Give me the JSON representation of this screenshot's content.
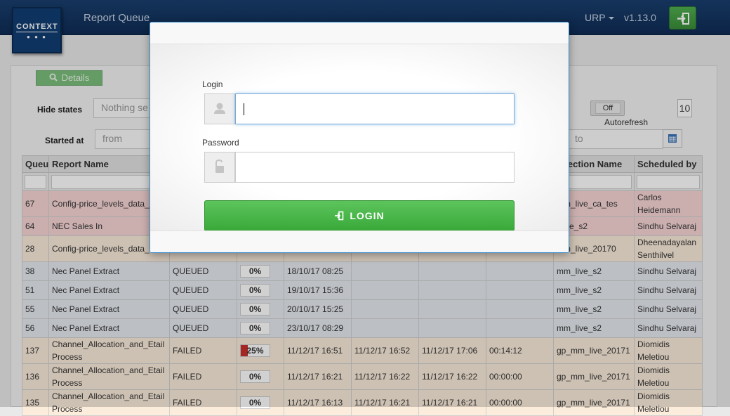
{
  "header": {
    "logo_text": "CONTEXT",
    "app_title": "Report Queue",
    "user_menu": "URP",
    "version": "v1.13.0"
  },
  "toolbar": {
    "details_label": "Details",
    "hide_states_label": "Hide states",
    "hide_states_placeholder": "Nothing se",
    "started_at_label": "Started at",
    "from_placeholder": "from",
    "to_placeholder": "to",
    "autorefresh_state": "Off",
    "autorefresh_label": "Autorefresh",
    "page_size": "10"
  },
  "table": {
    "columns": [
      "Queu",
      "Report Name",
      "",
      "",
      "",
      "",
      "",
      "",
      "nnection Name",
      "Scheduled by"
    ],
    "rows": [
      {
        "id": "67",
        "name": "Config-price_levels_data_feed",
        "status": "",
        "progress": "",
        "created": "",
        "started": "",
        "finished": "",
        "duration": "",
        "connection": "mm_live_ca_tes",
        "scheduled_by": "Carlos Heidemann"
      },
      {
        "id": "64",
        "name": "NEC Sales In",
        "status": "",
        "progress": "",
        "created": "",
        "started": "",
        "finished": "",
        "duration": "",
        "connection": "_live_s2",
        "scheduled_by": "Sindhu Selvaraj"
      },
      {
        "id": "28",
        "name": "Config-price_levels_data_feed",
        "status": "",
        "progress": "",
        "created": "",
        "started": "",
        "finished": "",
        "duration": "",
        "connection": "mm_live_20170",
        "scheduled_by": "Dheenadayalan Senthilvel"
      },
      {
        "id": "38",
        "name": "Nec Panel Extract",
        "status": "QUEUED",
        "progress": "0%",
        "created": "18/10/17 08:25",
        "started": "",
        "finished": "",
        "duration": "",
        "connection": "mm_live_s2",
        "scheduled_by": "Sindhu Selvaraj"
      },
      {
        "id": "51",
        "name": "Nec Panel Extract",
        "status": "QUEUED",
        "progress": "0%",
        "created": "19/10/17 15:36",
        "started": "",
        "finished": "",
        "duration": "",
        "connection": "mm_live_s2",
        "scheduled_by": "Sindhu Selvaraj"
      },
      {
        "id": "55",
        "name": "Nec Panel Extract",
        "status": "QUEUED",
        "progress": "0%",
        "created": "20/10/17 15:25",
        "started": "",
        "finished": "",
        "duration": "",
        "connection": "mm_live_s2",
        "scheduled_by": "Sindhu Selvaraj"
      },
      {
        "id": "56",
        "name": "Nec Panel Extract",
        "status": "QUEUED",
        "progress": "0%",
        "created": "23/10/17 08:29",
        "started": "",
        "finished": "",
        "duration": "",
        "connection": "mm_live_s2",
        "scheduled_by": "Sindhu Selvaraj"
      },
      {
        "id": "137",
        "name": "Channel_Allocation_and_Etail Process",
        "status": "FAILED",
        "progress": "25%",
        "created": "11/12/17 16:51",
        "started": "11/12/17 16:52",
        "finished": "11/12/17 17:06",
        "duration": "00:14:12",
        "connection": "gp_mm_live_20171",
        "scheduled_by": "Diomidis Meletiou"
      },
      {
        "id": "136",
        "name": "Channel_Allocation_and_Etail Process",
        "status": "FAILED",
        "progress": "0%",
        "created": "11/12/17 16:21",
        "started": "11/12/17 16:22",
        "finished": "11/12/17 16:22",
        "duration": "00:00:00",
        "connection": "gp_mm_live_20171",
        "scheduled_by": "Diomidis Meletiou"
      },
      {
        "id": "135",
        "name": "Channel_Allocation_and_Etail Process",
        "status": "FAILED",
        "progress": "0%",
        "created": "11/12/17 16:13",
        "started": "11/12/17 16:21",
        "finished": "11/12/17 16:21",
        "duration": "00:00:00",
        "connection": "gp_mm_live_20171",
        "scheduled_by": "Diomidis Meletiou"
      }
    ]
  },
  "login_modal": {
    "login_label": "Login",
    "login_value": "",
    "password_label": "Password",
    "password_value": "",
    "submit_label": "LOGIN"
  },
  "colors": {
    "header_bg": "#0e2c55",
    "success_green": "#39a939",
    "failed_red": "#d9443e",
    "focus_blue": "#66afe9"
  }
}
